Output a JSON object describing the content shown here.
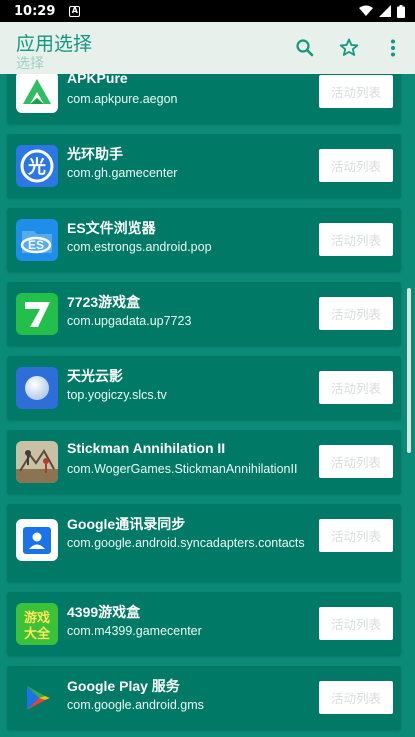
{
  "status_bar": {
    "time": "10:29",
    "notification_letter": "A"
  },
  "appbar": {
    "title": "应用选择",
    "ghost_text": "选择",
    "icons": [
      "search-icon",
      "star-outline-icon",
      "more-vert-icon"
    ]
  },
  "colors": {
    "background": "#0b8a78",
    "card": "#007a66",
    "appbar": "#e8f0ec",
    "accent": "#14987e"
  },
  "apps": [
    {
      "name": "APKPure",
      "package": "com.apkpure.aegon",
      "button": "活动列表",
      "icon": "apkpure-icon"
    },
    {
      "name": "光环助手",
      "package": "com.gh.gamecenter",
      "button": "活动列表",
      "icon": "guanghuan-icon"
    },
    {
      "name": "ES文件浏览器",
      "package": "com.estrongs.android.pop",
      "button": "活动列表",
      "icon": "es-file-icon"
    },
    {
      "name": "7723游戏盒",
      "package": "com.upgadata.up7723",
      "button": "活动列表",
      "icon": "7723-icon"
    },
    {
      "name": "天光云影",
      "package": "top.yogiczy.slcs.tv",
      "button": "活动列表",
      "icon": "tianguang-icon"
    },
    {
      "name": "Stickman Annihilation II",
      "package": "com.WogerGames.StickmanAnnihilationII",
      "button": "活动列表",
      "icon": "stickman-icon"
    },
    {
      "name": "Google通讯录同步",
      "package": "com.google.android.syncadapters.contacts",
      "button": "活动列表",
      "icon": "google-contacts-icon"
    },
    {
      "name": "4399游戏盒",
      "package": "com.m4399.gamecenter",
      "button": "活动列表",
      "icon": "4399-icon"
    },
    {
      "name": "Google Play 服务",
      "package": "com.google.android.gms",
      "button": "活动列表",
      "icon": "google-play-services-icon"
    }
  ]
}
